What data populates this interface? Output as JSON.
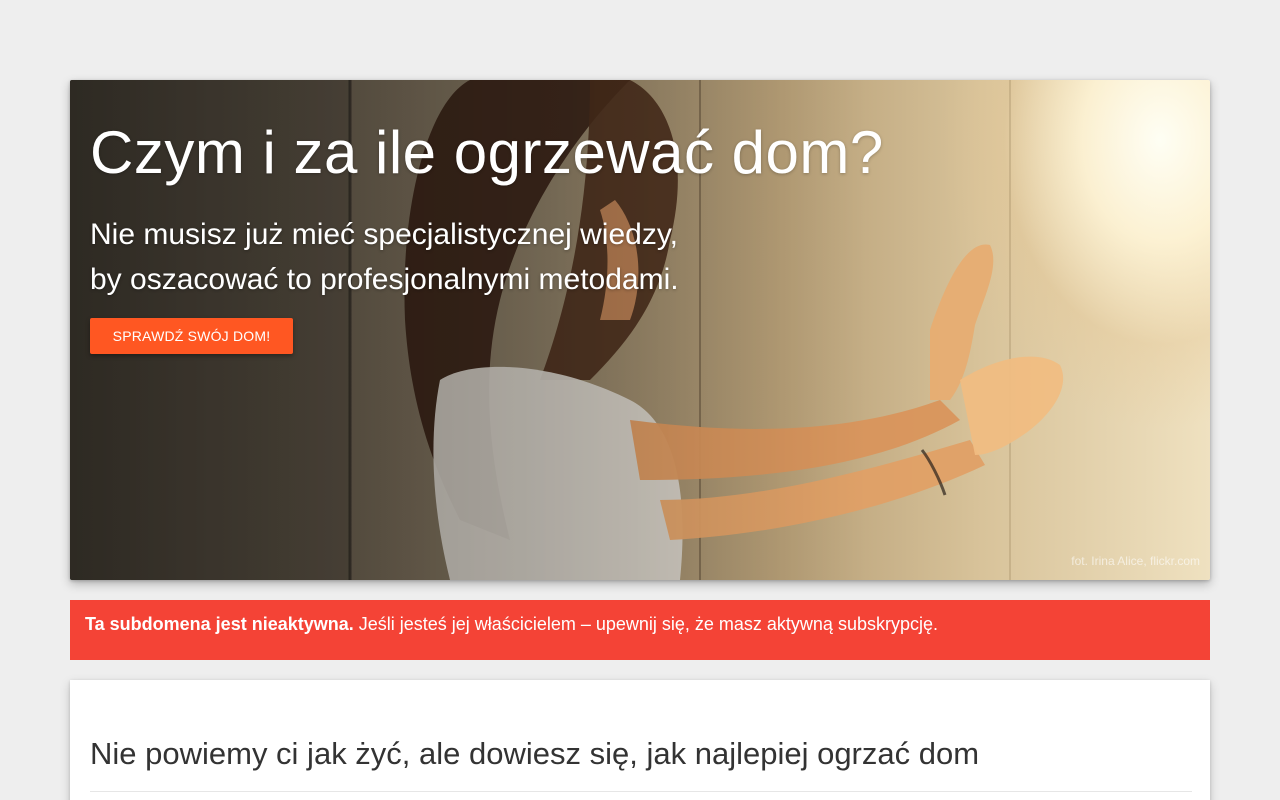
{
  "hero": {
    "title": "Czym i za ile ogrzewać dom?",
    "subtitle_line1": "Nie musisz już mieć specjalistycznej wiedzy,",
    "subtitle_line2": "by oszacować to profesjonalnymi metodami.",
    "cta_label": "SPRAWDŹ SWÓJ DOM!",
    "photo_credit": "fot. Irina Alice, flickr.com"
  },
  "alert": {
    "bold_text": "Ta subdomena jest nieaktywna.",
    "text": "Jeśli jesteś jej właścicielem – upewnij się, że masz aktywną subskrypcję."
  },
  "content": {
    "heading": "Nie powiemy ci jak żyć, ale dowiesz się, jak najlepiej ogrzać dom"
  },
  "colors": {
    "accent": "#ff5722",
    "alert_bg": "#f44336",
    "page_bg": "#eeeeee"
  }
}
